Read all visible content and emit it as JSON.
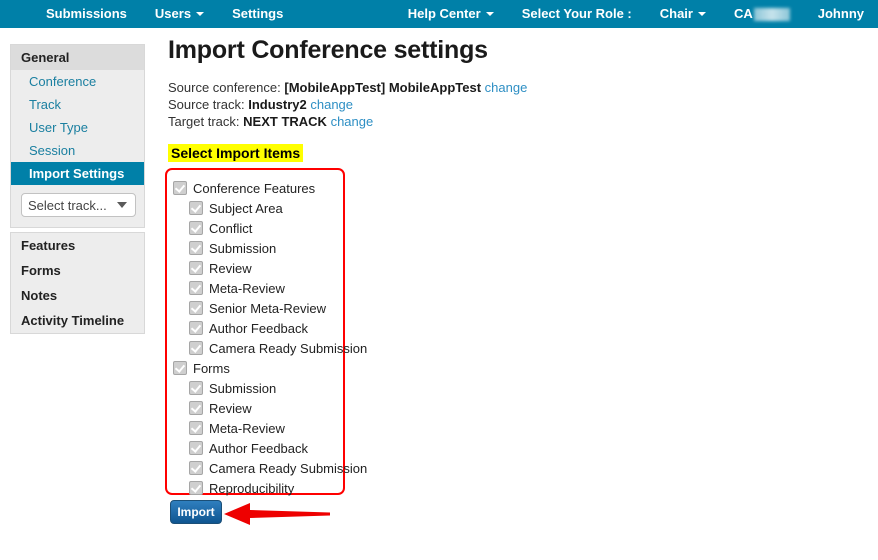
{
  "topnav": {
    "background": "#0080a8",
    "left_items": [
      {
        "label": "Submissions",
        "caret": false
      },
      {
        "label": "Users",
        "caret": true
      },
      {
        "label": "Settings",
        "caret": false
      }
    ],
    "right_items": [
      {
        "label": "Help Center",
        "caret": true
      },
      {
        "label": "Select Your Role :",
        "caret": false
      },
      {
        "label": "Chair",
        "caret": true
      }
    ],
    "conference_code": "CA",
    "conference_code_redacted": true,
    "user": "Johnny"
  },
  "sidebar": {
    "general": {
      "header": "General",
      "links": [
        {
          "label": "Conference",
          "active": false
        },
        {
          "label": "Track",
          "active": false
        },
        {
          "label": "User Type",
          "active": false
        },
        {
          "label": "Session",
          "active": false
        },
        {
          "label": "Import Settings",
          "active": true
        }
      ],
      "track_select": {
        "value": "Select track...",
        "options": [
          "Select track..."
        ]
      }
    },
    "items": [
      {
        "label": "Features"
      },
      {
        "label": "Forms"
      },
      {
        "label": "Notes"
      },
      {
        "label": "Activity Timeline"
      }
    ]
  },
  "main": {
    "title": "Import Conference settings",
    "meta": [
      {
        "label": "Source conference:",
        "value": "[MobileAppTest] MobileAppTest",
        "change": "change"
      },
      {
        "label": "Source track:",
        "value": "Industry2",
        "change": "change"
      },
      {
        "label": "Target track:",
        "value": "NEXT TRACK",
        "change": "change"
      }
    ],
    "section_title": "Select Import Items",
    "section_title_highlight": "#ffff00",
    "import_items": [
      {
        "label": "Conference Features",
        "checked": true,
        "level": 0
      },
      {
        "label": "Subject Area",
        "checked": true,
        "level": 1
      },
      {
        "label": "Conflict",
        "checked": true,
        "level": 1
      },
      {
        "label": "Submission",
        "checked": true,
        "level": 1
      },
      {
        "label": "Review",
        "checked": true,
        "level": 1
      },
      {
        "label": "Meta-Review",
        "checked": true,
        "level": 1
      },
      {
        "label": "Senior Meta-Review",
        "checked": true,
        "level": 1
      },
      {
        "label": "Author Feedback",
        "checked": true,
        "level": 1
      },
      {
        "label": "Camera Ready Submission",
        "checked": true,
        "level": 1
      },
      {
        "label": "Forms",
        "checked": true,
        "level": 0
      },
      {
        "label": "Submission",
        "checked": true,
        "level": 1
      },
      {
        "label": "Review",
        "checked": true,
        "level": 1
      },
      {
        "label": "Meta-Review",
        "checked": true,
        "level": 1
      },
      {
        "label": "Author Feedback",
        "checked": true,
        "level": 1
      },
      {
        "label": "Camera Ready Submission",
        "checked": true,
        "level": 1
      },
      {
        "label": "Reproducibility",
        "checked": true,
        "level": 1
      }
    ],
    "panel_highlight_color": "#ff0000",
    "import_button": "Import",
    "annotation_arrow_color": "#ee0000"
  }
}
